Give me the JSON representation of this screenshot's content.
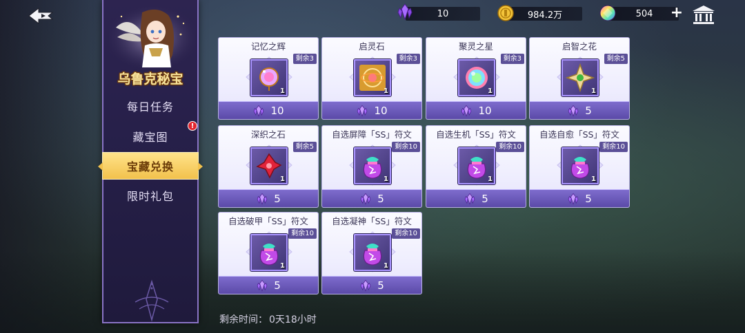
{
  "currency": {
    "gems": "10",
    "gold": "984.2万",
    "crystals": "504"
  },
  "sidebar": {
    "title": "乌鲁克秘宝",
    "items": [
      {
        "label": "每日任务"
      },
      {
        "label": "藏宝图",
        "alert": "!"
      },
      {
        "label": "宝藏兑换",
        "active": true
      },
      {
        "label": "限时礼包"
      }
    ]
  },
  "shop": {
    "items": [
      {
        "title": "记忆之辉",
        "remain": "剩余3",
        "qty": "1",
        "price": "10",
        "icon": "memory-glow-icon"
      },
      {
        "title": "启灵石",
        "remain": "剩余3",
        "qty": "1",
        "price": "10",
        "icon": "spirit-stone-icon"
      },
      {
        "title": "聚灵之星",
        "remain": "剩余3",
        "qty": "1",
        "price": "10",
        "icon": "spirit-star-icon"
      },
      {
        "title": "启智之花",
        "remain": "剩余5",
        "qty": "1",
        "price": "5",
        "icon": "wisdom-flower-icon"
      },
      {
        "title": "深织之石",
        "remain": "剩余5",
        "qty": "1",
        "price": "5",
        "icon": "deep-weave-stone-icon"
      },
      {
        "title": "自选屏障「SS」符文",
        "remain": "剩余10",
        "qty": "1",
        "price": "5",
        "icon": "rune-bag-icon"
      },
      {
        "title": "自选生机「SS」符文",
        "remain": "剩余10",
        "qty": "1",
        "price": "5",
        "icon": "rune-bag-icon"
      },
      {
        "title": "自选自愈「SS」符文",
        "remain": "剩余10",
        "qty": "1",
        "price": "5",
        "icon": "rune-bag-icon"
      },
      {
        "title": "自选破甲「SS」符文",
        "remain": "剩余10",
        "qty": "1",
        "price": "5",
        "icon": "rune-bag-icon"
      },
      {
        "title": "自选凝神「SS」符文",
        "remain": "剩余10",
        "qty": "1",
        "price": "5",
        "icon": "rune-bag-icon"
      }
    ]
  },
  "footer": {
    "timer_label": "剩余时间：",
    "timer_value": "0天18小时"
  },
  "colors": {
    "panel": "#2d2450",
    "accent_gold": "#f2c14c",
    "price_bar": "#5b4aa8",
    "gem_purple": "#9b5cff"
  }
}
